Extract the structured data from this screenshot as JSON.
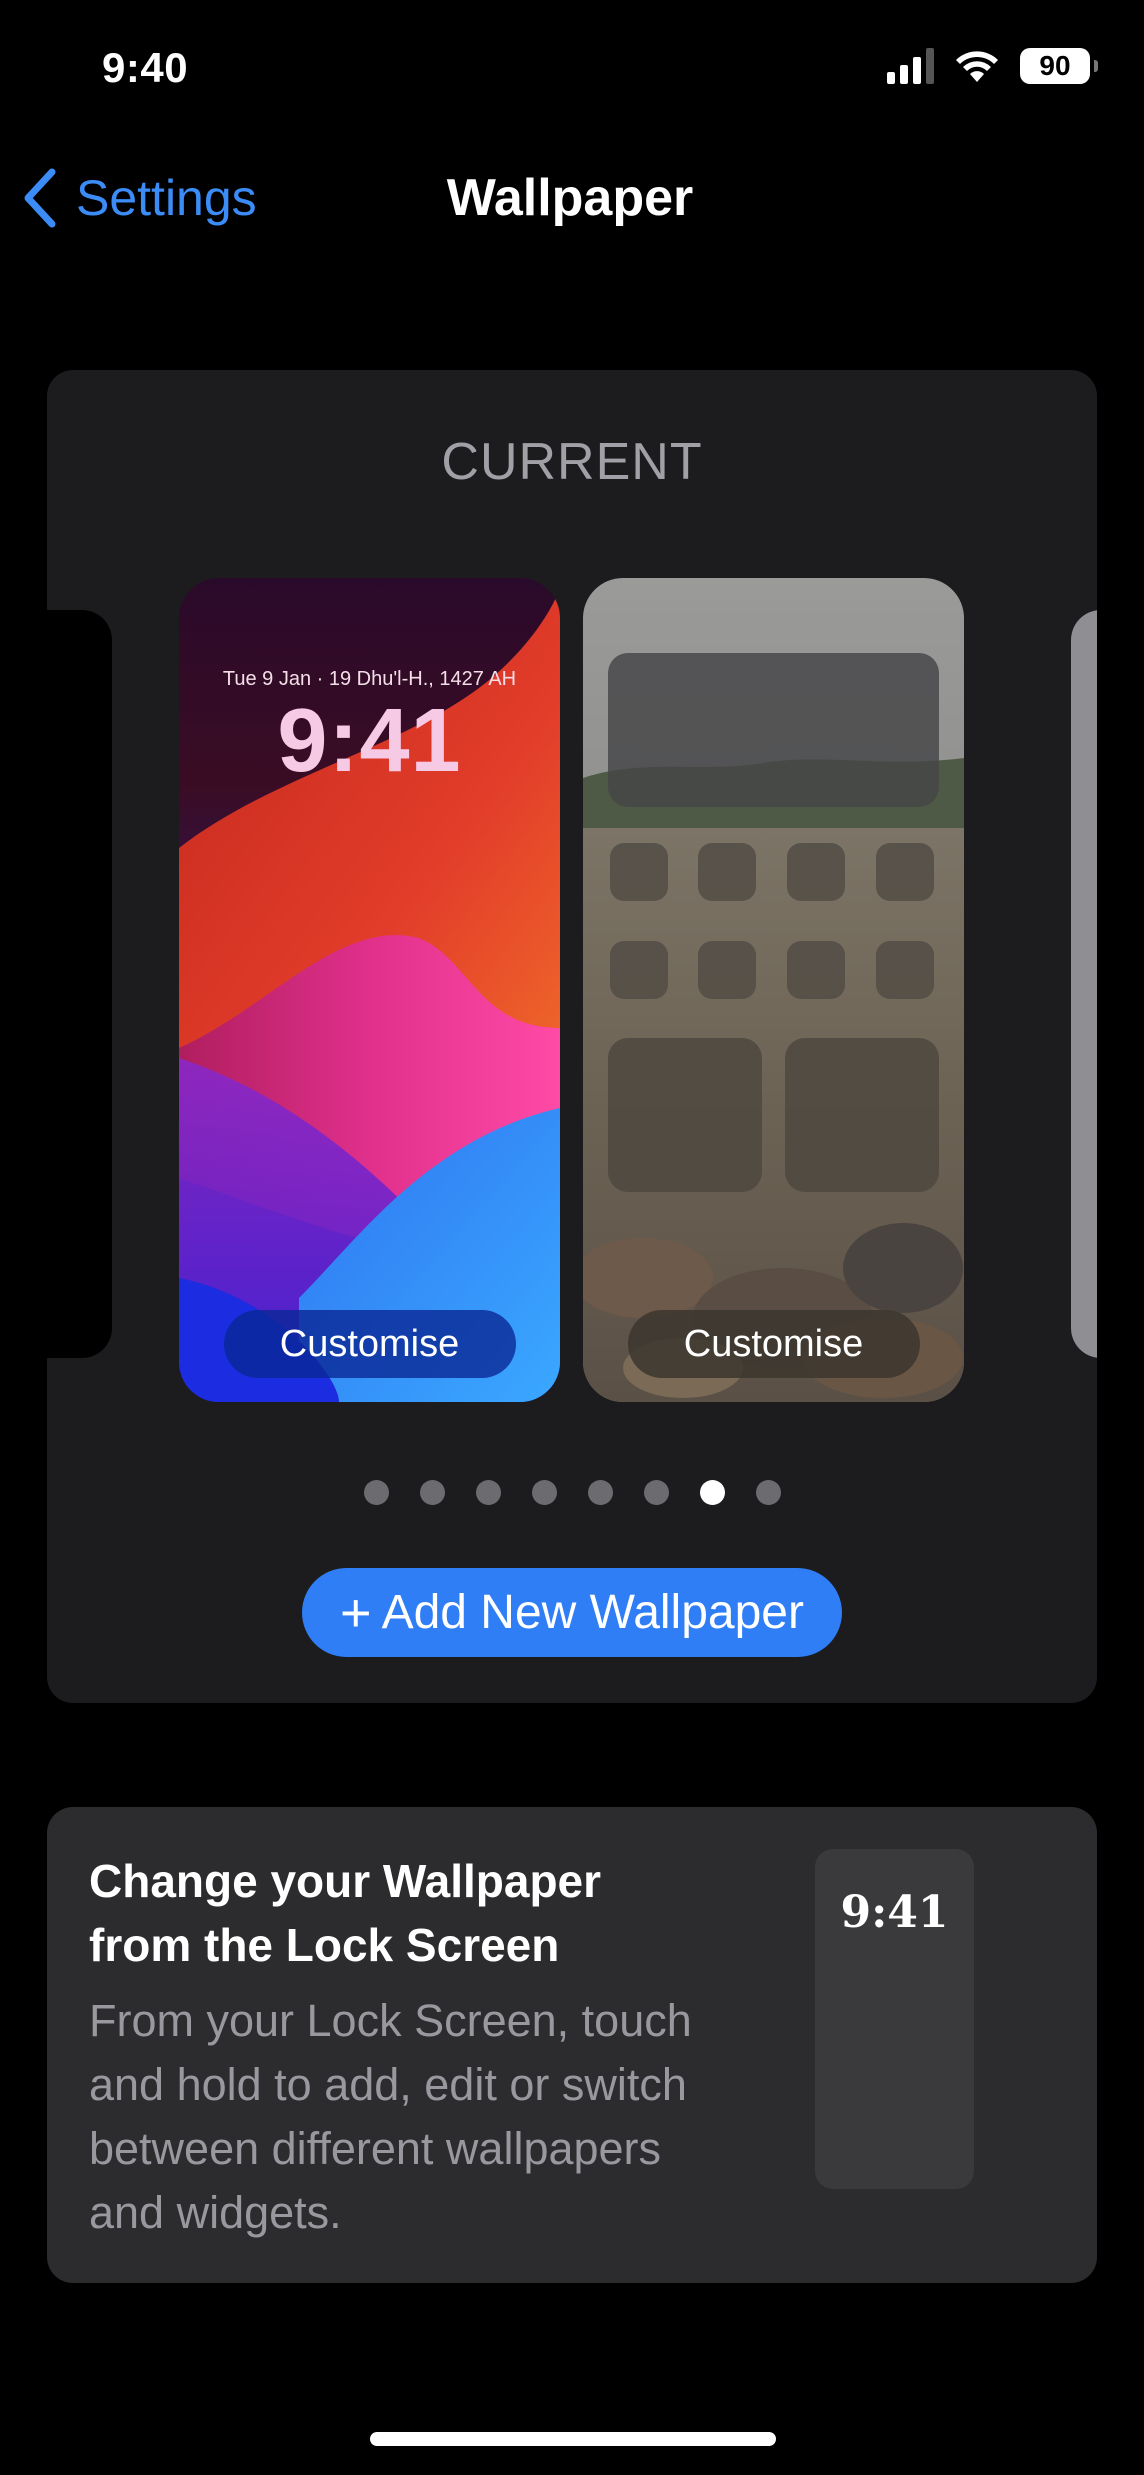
{
  "status_bar": {
    "time": "9:40",
    "battery": "90",
    "icons": [
      "cellular-signal-icon",
      "wifi-icon",
      "battery-icon"
    ]
  },
  "nav": {
    "back_label": "Settings",
    "title": "Wallpaper"
  },
  "current": {
    "section_label": "CURRENT",
    "lock_screen": {
      "date_text": "Tue 9 Jan · 19 Dhu'l-H., 1427 AH",
      "time_text": "9:41",
      "customise_label": "Customise"
    },
    "home_screen": {
      "customise_label": "Customise"
    },
    "page_indicator": {
      "total": 8,
      "current_index": 7
    },
    "add_button_label": "Add New Wallpaper"
  },
  "info": {
    "title": "Change your Wallpaper from the Lock Screen",
    "body": "From your Lock Screen, touch and hold to add, edit or switch between different wallpapers and widgets.",
    "mini_time": "9:41"
  },
  "colors": {
    "accent": "#3b8cf6",
    "button_blue": "#2f7ef6",
    "panel_bg": "#1c1c1e",
    "info_bg": "#2c2c2e"
  }
}
